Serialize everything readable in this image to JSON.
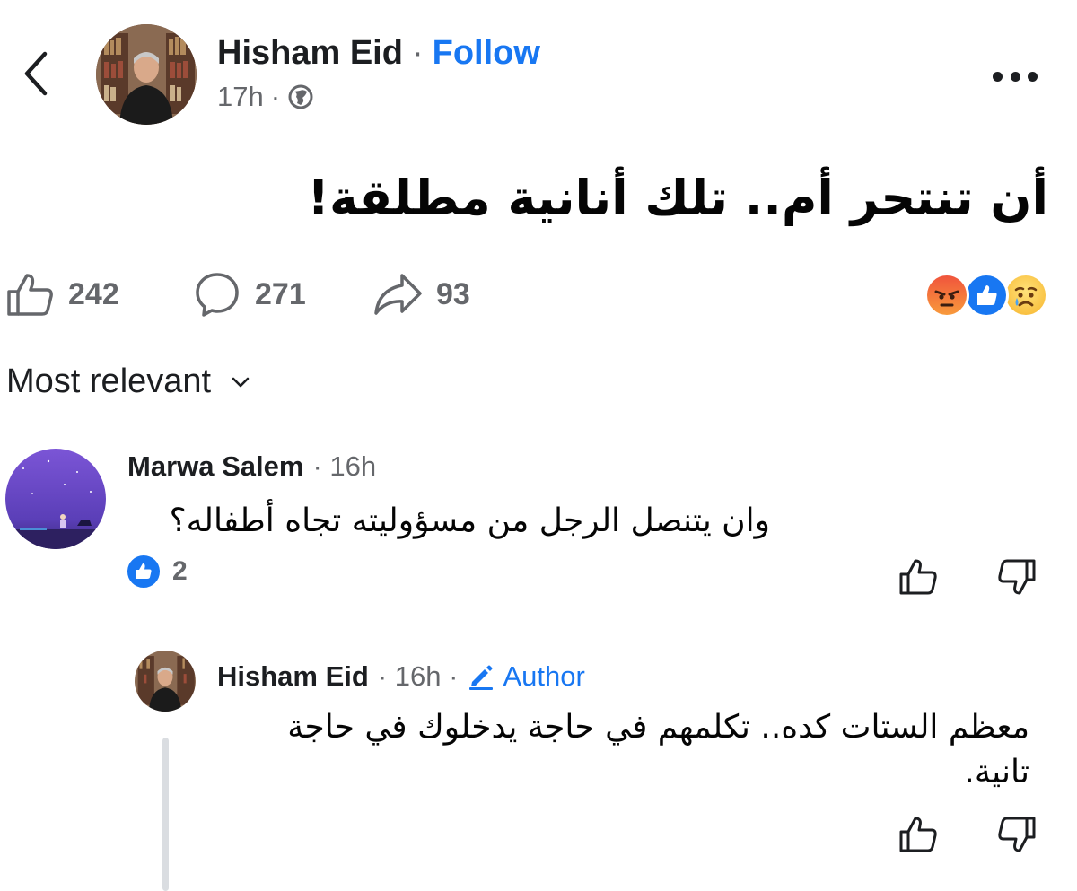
{
  "header": {
    "author_name": "Hisham Eid",
    "separator": "·",
    "follow_label": "Follow",
    "timestamp": "17h",
    "meta_separator": "·",
    "privacy_icon": "globe-icon"
  },
  "post": {
    "text": "أن تنتحر أم.. تلك أنانية مطلقة!",
    "likes": "242",
    "comments": "271",
    "shares": "93",
    "reactions": [
      "angry",
      "like",
      "sad"
    ]
  },
  "comments_sort": {
    "label": "Most relevant"
  },
  "comments": [
    {
      "author": "Marwa Salem",
      "time": "· 16h",
      "text": "وان يتنصل الرجل من مسؤوليته تجاه أطفاله؟",
      "reaction_count": "2"
    }
  ],
  "replies": [
    {
      "author": "Hisham Eid",
      "time": "· 16h ·",
      "badge": "Author",
      "text": "معظم الستات كده.. تكلمهم في حاجة يدخلوك في حاجة تانية."
    }
  ],
  "colors": {
    "accent": "#1877f2",
    "muted": "#65676b",
    "text": "#1c1e21"
  }
}
